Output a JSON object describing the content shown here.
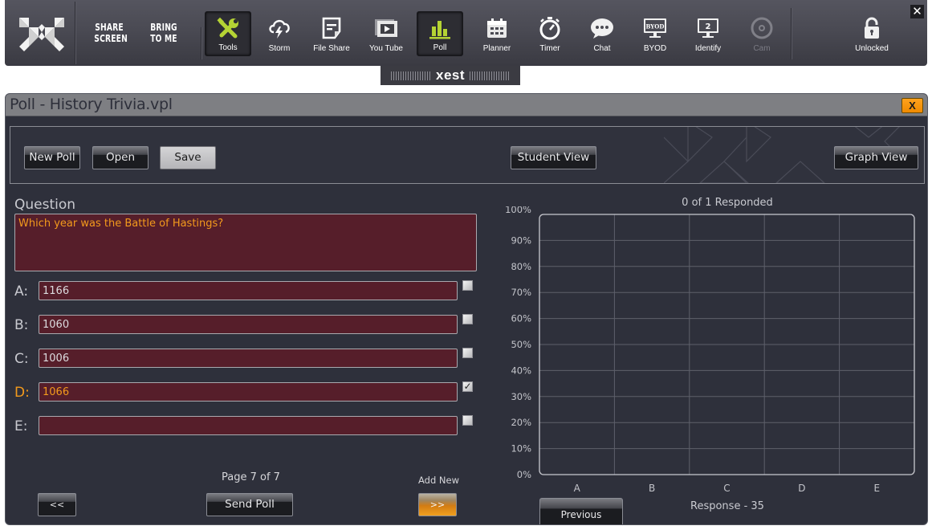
{
  "toolbar": {
    "logo": "xest-logo",
    "share_screen": "SHARE\nSCREEN",
    "share_screen_line1": "SHARE",
    "share_screen_line2": "SCREEN",
    "bring_to_me_line1": "BRING",
    "bring_to_me_line2": "TO ME",
    "tools": [
      {
        "id": "tools",
        "label": "Tools",
        "icon": "tools-icon",
        "active": true
      },
      {
        "id": "storm",
        "label": "Storm",
        "icon": "storm-cloud-icon"
      },
      {
        "id": "fileshare",
        "label": "File Share",
        "icon": "file-share-icon"
      },
      {
        "id": "youtube",
        "label": "You Tube",
        "icon": "video-icon"
      },
      {
        "id": "poll",
        "label": "Poll",
        "icon": "bar-chart-icon",
        "active": true
      },
      {
        "id": "planner",
        "label": "Planner",
        "icon": "calendar-icon"
      },
      {
        "id": "timer",
        "label": "Timer",
        "icon": "stopwatch-icon"
      },
      {
        "id": "chat",
        "label": "Chat",
        "icon": "chat-bubble-icon"
      },
      {
        "id": "byod",
        "label": "BYOD",
        "icon": "byod-monitor-icon",
        "screen_text": "BYOD"
      },
      {
        "id": "identify",
        "label": "Identify",
        "icon": "identify-monitor-icon",
        "screen_text": "2"
      },
      {
        "id": "cam",
        "label": "Cam",
        "icon": "camera-icon",
        "disabled": true
      }
    ],
    "lock_label": "Unlocked",
    "close_glyph": "✕",
    "brand_tab": "xest"
  },
  "colors": {
    "accent_green": "#b5d334",
    "accent_orange": "#f39a1c",
    "field_bg": "#561e2a",
    "window_bg": "#2e303b"
  },
  "window": {
    "title": "Poll - History Trivia.vpl",
    "close_label": "X",
    "buttons": {
      "new_poll": "New Poll",
      "open": "Open",
      "save": "Save",
      "student_view": "Student View",
      "graph_view": "Graph View"
    }
  },
  "editor": {
    "question_label": "Question",
    "question_text": "Which year was the Battle of Hastings?",
    "answers": [
      {
        "letter": "A:",
        "value": "1166",
        "correct": false
      },
      {
        "letter": "B:",
        "value": "1060",
        "correct": false
      },
      {
        "letter": "C:",
        "value": "1006",
        "correct": false
      },
      {
        "letter": "D:",
        "value": "1066",
        "correct": true
      },
      {
        "letter": "E:",
        "value": "",
        "correct": false
      }
    ],
    "page_label": "Page 7 of 7",
    "add_new_label": "Add New",
    "prev_page": "<<",
    "send_poll": "Send Poll",
    "next_page": ">>"
  },
  "results": {
    "responded_label": "0 of 1 Responded",
    "previous_button": "Previous",
    "response_label": "Response - 35"
  },
  "chart_data": {
    "type": "bar",
    "title": "0 of 1 Responded",
    "categories": [
      "A",
      "B",
      "C",
      "D",
      "E"
    ],
    "values": [
      0,
      0,
      0,
      0,
      0
    ],
    "xlabel": "",
    "ylabel": "",
    "ylim": [
      0,
      100
    ],
    "yticks": [
      "0%",
      "10%",
      "20%",
      "30%",
      "40%",
      "50%",
      "60%",
      "70%",
      "80%",
      "90%",
      "100%"
    ],
    "grid": true
  }
}
